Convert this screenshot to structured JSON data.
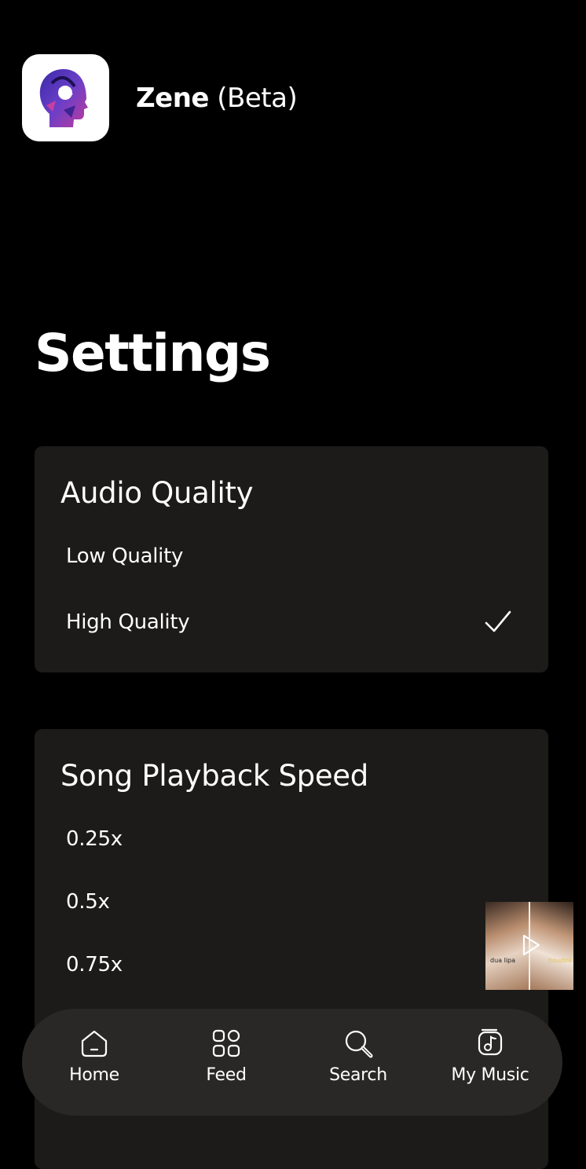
{
  "header": {
    "app_name": "Zene",
    "app_suffix": "(Beta)",
    "logo_icon": "head-silhouette-logo-icon"
  },
  "page": {
    "title": "Settings"
  },
  "audio_quality": {
    "title": "Audio Quality",
    "options": [
      {
        "label": "Low Quality",
        "selected": false
      },
      {
        "label": "High Quality",
        "selected": true
      }
    ]
  },
  "playback_speed": {
    "title": "Song Playback Speed",
    "options": [
      {
        "label": "0.25x"
      },
      {
        "label": "0.5x"
      },
      {
        "label": "0.75x"
      }
    ]
  },
  "mini_player": {
    "artist_text": "dua lipa",
    "album_text": "houdini",
    "icon": "play-icon"
  },
  "bottom_nav": {
    "items": [
      {
        "label": "Home",
        "icon": "home-icon"
      },
      {
        "label": "Feed",
        "icon": "grid-icon"
      },
      {
        "label": "Search",
        "icon": "search-icon"
      },
      {
        "label": "My Music",
        "icon": "music-note-icon"
      }
    ]
  },
  "colors": {
    "background": "#000000",
    "card": "#1c1b1a",
    "nav": "#2a2827",
    "text": "#ffffff"
  }
}
